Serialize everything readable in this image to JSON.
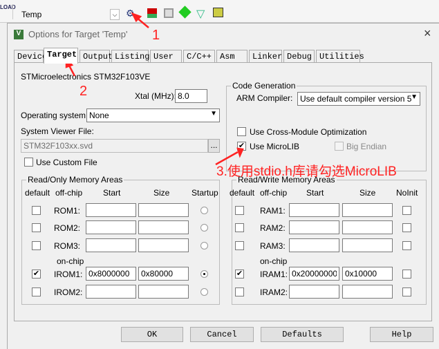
{
  "toolbar": {
    "load_label": "LOAD",
    "target_select": "Temp",
    "icons": [
      "load-icon",
      "options-for-target-icon",
      "manage-project-items-icon",
      "window-layout-icon",
      "pack-installer-icon",
      "select-software-packs-icon",
      "manage-runtime-icon"
    ]
  },
  "dialog": {
    "title": "Options for Target 'Temp'",
    "close": "×",
    "tabs": [
      "Device",
      "Target",
      "Output",
      "Listing",
      "User",
      "C/C++",
      "Asm",
      "Linker",
      "Debug",
      "Utilities"
    ],
    "selected_tab": "Target",
    "device_name": "STMicroelectronics STM32F103VE",
    "xtal_label": "Xtal (MHz):",
    "xtal_value": "8.0",
    "os_label": "Operating system:",
    "os_value": "None",
    "svf_label": "System Viewer File:",
    "svf_value": "STM32F103xx.svd",
    "browse": "...",
    "custom_file_label": "Use Custom File",
    "code_gen": {
      "title": "Code Generation",
      "compiler_label": "ARM Compiler:",
      "compiler_value": "Use default compiler version 5",
      "cross_module": "Use Cross-Module Optimization",
      "microlib": "Use MicroLIB",
      "big_endian": "Big Endian"
    },
    "rom": {
      "title": "Read/Only Memory Areas",
      "headers": [
        "default",
        "off-chip",
        "Start",
        "Size",
        "Startup"
      ],
      "onchip": "on-chip",
      "rows": [
        {
          "label": "ROM1:",
          "start": "",
          "size": "",
          "default": false,
          "startup": false
        },
        {
          "label": "ROM2:",
          "start": "",
          "size": "",
          "default": false,
          "startup": false
        },
        {
          "label": "ROM3:",
          "start": "",
          "size": "",
          "default": false,
          "startup": false
        },
        {
          "label": "IROM1:",
          "start": "0x8000000",
          "size": "0x80000",
          "default": true,
          "startup": true
        },
        {
          "label": "IROM2:",
          "start": "",
          "size": "",
          "default": false,
          "startup": false
        }
      ]
    },
    "ram": {
      "title": "Read/Write Memory Areas",
      "headers": [
        "default",
        "off-chip",
        "Start",
        "Size",
        "NoInit"
      ],
      "onchip": "on-chip",
      "rows": [
        {
          "label": "RAM1:",
          "start": "",
          "size": "",
          "default": false
        },
        {
          "label": "RAM2:",
          "start": "",
          "size": "",
          "default": false
        },
        {
          "label": "RAM3:",
          "start": "",
          "size": "",
          "default": false
        },
        {
          "label": "IRAM1:",
          "start": "0x20000000",
          "size": "0x10000",
          "default": true
        },
        {
          "label": "IRAM2:",
          "start": "",
          "size": "",
          "default": false
        }
      ]
    },
    "buttons": {
      "ok": "OK",
      "cancel": "Cancel",
      "defaults": "Defaults",
      "help": "Help"
    }
  },
  "annotations": {
    "a1": "1",
    "a2": "2",
    "a3": "3.使用stdio.h库请勾选MicroLIB",
    "color": "#ff2222"
  }
}
